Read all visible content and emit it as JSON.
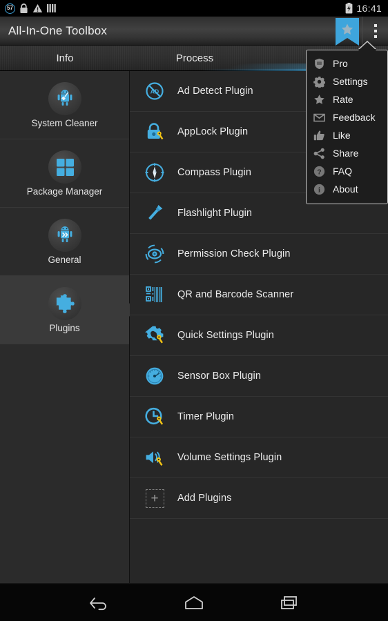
{
  "statusbar": {
    "badge": "57",
    "icons": [
      "badge-57-icon",
      "lock-icon",
      "warning-triangle-icon",
      "signal-bars-icon"
    ],
    "battery_icon": "battery-charging-icon",
    "clock": "16:41"
  },
  "actionbar": {
    "title": "All-In-One Toolbox",
    "bookmark_icon": "bookmark-star-icon",
    "overflow_icon": "overflow-menu-icon",
    "accent_color": "#3ea5dc"
  },
  "tabs": [
    {
      "label": "Info",
      "selected": false
    },
    {
      "label": "Process",
      "selected": false
    },
    {
      "label": "",
      "selected": true
    }
  ],
  "sidebar": {
    "items": [
      {
        "label": "System Cleaner",
        "icon": "android-broom-icon",
        "selected": false
      },
      {
        "label": "Package Manager",
        "icon": "four-squares-icon",
        "selected": false
      },
      {
        "label": "General",
        "icon": "android-chevron-icon",
        "selected": false
      },
      {
        "label": "Plugins",
        "icon": "puzzle-piece-icon",
        "selected": true
      }
    ]
  },
  "plugins": {
    "items": [
      {
        "label": "Ad Detect Plugin",
        "icon": "ad-detect-icon"
      },
      {
        "label": "AppLock Plugin",
        "icon": "lock-key-icon"
      },
      {
        "label": "Compass Plugin",
        "icon": "compass-icon"
      },
      {
        "label": "Flashlight Plugin",
        "icon": "flashlight-icon"
      },
      {
        "label": "Permission Check Plugin",
        "icon": "eye-target-icon"
      },
      {
        "label": "QR and Barcode Scanner",
        "icon": "qr-barcode-icon"
      },
      {
        "label": "Quick Settings Plugin",
        "icon": "gear-wrench-icon"
      },
      {
        "label": "Sensor Box Plugin",
        "icon": "gauge-icon"
      },
      {
        "label": "Timer Plugin",
        "icon": "clock-wrench-icon"
      },
      {
        "label": "Volume Settings Plugin",
        "icon": "speaker-wrench-icon"
      },
      {
        "label": "Add Plugins",
        "icon": "plus-dashed-icon"
      }
    ]
  },
  "menu": {
    "items": [
      {
        "label": "Pro",
        "icon": "shield-icon"
      },
      {
        "label": "Settings",
        "icon": "gear-icon"
      },
      {
        "label": "Rate",
        "icon": "star-icon"
      },
      {
        "label": "Feedback",
        "icon": "envelope-icon"
      },
      {
        "label": "Like",
        "icon": "thumbs-up-icon"
      },
      {
        "label": "Share",
        "icon": "share-icon"
      },
      {
        "label": "FAQ",
        "icon": "question-circle-icon"
      },
      {
        "label": "About",
        "icon": "info-circle-icon"
      }
    ]
  },
  "navbar": {
    "buttons": [
      {
        "name": "back-button",
        "icon": "back-arrow-icon"
      },
      {
        "name": "home-button",
        "icon": "home-icon"
      },
      {
        "name": "recents-button",
        "icon": "recents-icon"
      }
    ]
  }
}
